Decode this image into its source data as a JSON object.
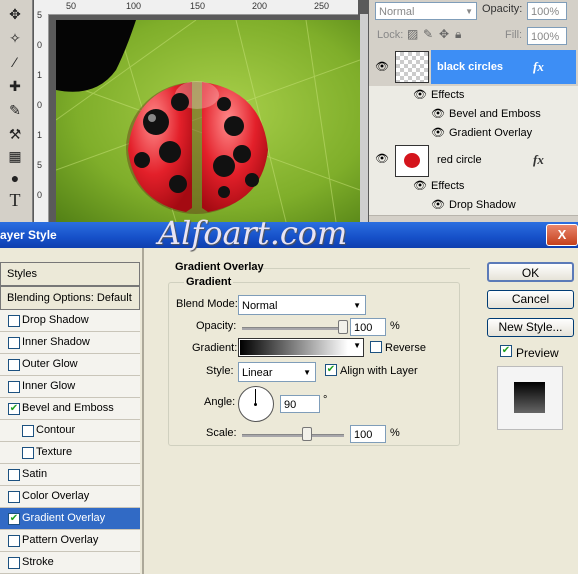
{
  "layers": {
    "blend_mode": "Normal",
    "opacity_label": "Opacity:",
    "opacity": "100%",
    "lock_label": "Lock:",
    "fill_label": "Fill:",
    "fill": "100%",
    "rows": [
      {
        "name": "black circles",
        "fx": "fx"
      },
      {
        "name": "Effects"
      },
      {
        "name": "Bevel and Emboss"
      },
      {
        "name": "Gradient Overlay"
      },
      {
        "name": "red circle",
        "fx": "fx"
      },
      {
        "name": "Effects"
      },
      {
        "name": "Drop Shadow"
      }
    ]
  },
  "ruler": {
    "h": [
      "50",
      "100",
      "150",
      "200",
      "250"
    ],
    "v": [
      "5",
      "0",
      "1",
      "0",
      "1",
      "5",
      "0"
    ]
  },
  "dialog": {
    "title": "ayer Style",
    "watermark": "Alfoart.com",
    "close": "X",
    "styles_header": "Styles",
    "blending": "Blending Options: Default",
    "effects": [
      {
        "label": "Drop Shadow",
        "checked": false
      },
      {
        "label": "Inner Shadow",
        "checked": false
      },
      {
        "label": "Outer Glow",
        "checked": false
      },
      {
        "label": "Inner Glow",
        "checked": false
      },
      {
        "label": "Bevel and Emboss",
        "checked": true
      },
      {
        "label": "Contour",
        "checked": false
      },
      {
        "label": "Texture",
        "checked": false
      },
      {
        "label": "Satin",
        "checked": false
      },
      {
        "label": "Color Overlay",
        "checked": false
      },
      {
        "label": "Gradient Overlay",
        "checked": true
      },
      {
        "label": "Pattern Overlay",
        "checked": false
      },
      {
        "label": "Stroke",
        "checked": false
      }
    ],
    "section_title": "Gradient Overlay",
    "group_title": "Gradient",
    "blend_mode_label": "Blend Mode:",
    "blend_mode": "Normal",
    "opacity_label": "Opacity:",
    "opacity": "100",
    "opacity_pct": 100,
    "pct": "%",
    "gradient_label": "Gradient:",
    "reverse_label": "Reverse",
    "style_label": "Style:",
    "style": "Linear",
    "align_label": "Align with Layer",
    "angle_label": "Angle:",
    "angle": "90",
    "deg": "°",
    "scale_label": "Scale:",
    "scale": "100",
    "scale_pct": 100,
    "ok": "OK",
    "cancel": "Cancel",
    "new_style": "New Style...",
    "preview_label": "Preview"
  }
}
